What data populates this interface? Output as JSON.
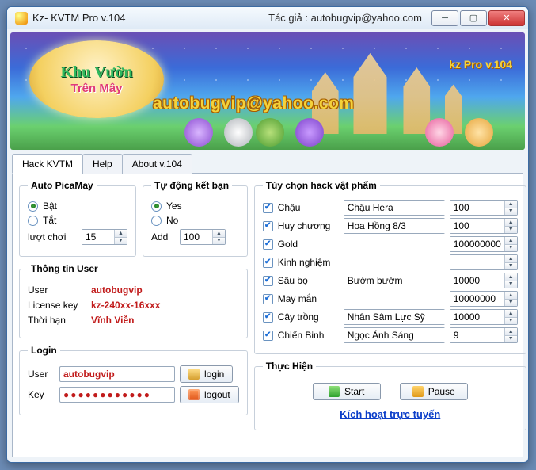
{
  "window": {
    "title": "Kz- KVTM Pro v.104",
    "author_label": "Tác giả : autobugvip@yahoo.com"
  },
  "banner": {
    "logo_line1": "Khu Vườn",
    "logo_line2": "Trên Mây",
    "email": "autobugvip@yahoo.com",
    "version": "kz Pro v.104"
  },
  "tabs": [
    "Hack KVTM",
    "Help",
    "About v.104"
  ],
  "auto_picamay": {
    "legend": "Auto PicaMay",
    "opt_on": "Bật",
    "opt_off": "Tắt",
    "plays_label": "lượt chơi",
    "plays_value": "15"
  },
  "auto_friend": {
    "legend": "Tự động kết bạn",
    "opt_yes": "Yes",
    "opt_no": "No",
    "add_label": "Add",
    "add_value": "100"
  },
  "user_info": {
    "legend": "Thông tin User",
    "user_label": "User",
    "user_value": "autobugvip",
    "license_label": "License key",
    "license_value": "kz-240xx-16xxx",
    "expiry_label": "Thời hạn",
    "expiry_value": "Vĩnh Viễn"
  },
  "login": {
    "legend": "Login",
    "user_label": "User",
    "user_value": "autobugvip",
    "key_label": "Key",
    "key_value": "●●●●●●●●●●●●",
    "login_btn": "login",
    "logout_btn": "logout"
  },
  "hack_items": {
    "legend": "Tùy chọn hack vật phẩm",
    "rows": [
      {
        "label": "Chậu",
        "combo": "Chậu Hera",
        "value": "100"
      },
      {
        "label": "Huy chương",
        "combo": "Hoa Hồng 8/3",
        "value": "100"
      },
      {
        "label": "Gold",
        "combo": null,
        "value": "100000000"
      },
      {
        "label": "Kinh nghiệm",
        "combo": null,
        "value": ""
      },
      {
        "label": "Sâu bọ",
        "combo": "Bướm bướm",
        "value": "10000"
      },
      {
        "label": "May mắn",
        "combo": null,
        "value": "10000000"
      },
      {
        "label": "Cây trồng",
        "combo": "Nhân Sâm Lực Sỹ",
        "value": "10000"
      },
      {
        "label": "Chiến Binh",
        "combo": "Ngọc Ánh Sáng",
        "value": "9"
      }
    ]
  },
  "execute": {
    "legend": "Thực Hiện",
    "start": "Start",
    "pause": "Pause",
    "link": "Kích hoạt trực tuyến"
  }
}
